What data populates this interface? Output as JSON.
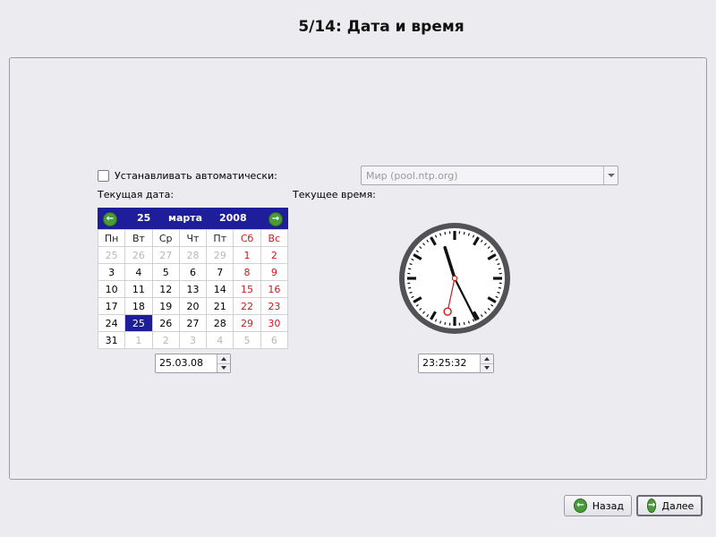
{
  "page_title": "5/14: Дата и время",
  "auto_sync": {
    "label": "Устанавливать автоматически:",
    "checked": false,
    "ntp_server": "Мир (pool.ntp.org)"
  },
  "date_section": {
    "label": "Текущая дата:",
    "calendar": {
      "day": "25",
      "month": "марта",
      "year": "2008",
      "weekdays": [
        "Пн",
        "Вт",
        "Ср",
        "Чт",
        "Пт",
        "Сб",
        "Вс"
      ],
      "weeks": [
        [
          "25",
          "26",
          "27",
          "28",
          "29",
          "1",
          "2"
        ],
        [
          "3",
          "4",
          "5",
          "6",
          "7",
          "8",
          "9"
        ],
        [
          "10",
          "11",
          "12",
          "13",
          "14",
          "15",
          "16"
        ],
        [
          "17",
          "18",
          "19",
          "20",
          "21",
          "22",
          "23"
        ],
        [
          "24",
          "25",
          "26",
          "27",
          "28",
          "29",
          "30"
        ],
        [
          "31",
          "1",
          "2",
          "3",
          "4",
          "5",
          "6"
        ]
      ],
      "selected_day": "25"
    },
    "date_value": "25.03.08"
  },
  "time_section": {
    "label": "Текущее время:",
    "time_value": "23:25:32"
  },
  "buttons": {
    "back": "Назад",
    "next": "Далее"
  },
  "colors": {
    "calendar_header": "#1e1e9a",
    "weekend": "#d01818",
    "accent_green": "#4a9b3a"
  }
}
